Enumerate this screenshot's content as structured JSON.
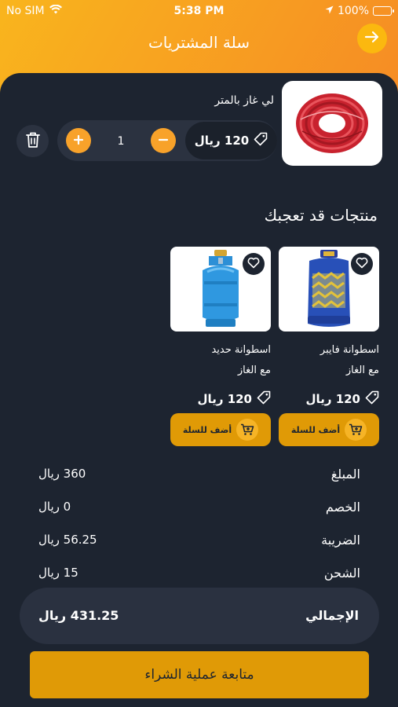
{
  "status_bar": {
    "carrier": "No SIM",
    "time": "5:38 PM",
    "battery": "100%"
  },
  "header": {
    "title": "سلة المشتريات",
    "back_icon": "arrow-right-icon"
  },
  "cart": {
    "items": [
      {
        "name": "لي غاز بالمتر",
        "price": "120 ريال",
        "quantity": "1",
        "image_icon": "red-gas-hose-image"
      }
    ]
  },
  "suggestions": {
    "title": "منتجات قد تعجبك",
    "products": [
      {
        "name": "اسطوانة فايبر",
        "subtitle": "مع الغاز",
        "price": "120 ريال",
        "add_label": "أضف للسلة",
        "image_icon": "blue-fiber-cylinder-image"
      },
      {
        "name": "اسطوانة حديد",
        "subtitle": "مع الغاز",
        "price": "120 ريال",
        "add_label": "أضف للسلة",
        "image_icon": "blue-steel-cylinder-image"
      }
    ]
  },
  "summary": {
    "amount_label": "المبلغ",
    "amount_value": "360 ريال",
    "discount_label": "الخصم",
    "discount_value": "0 ريال",
    "tax_label": "الضريبة",
    "tax_value": "56.25 ريال",
    "shipping_label": "الشحن",
    "shipping_value": "15 ريال",
    "total_label": "الإجمالي",
    "total_value": "431.25 ريال"
  },
  "checkout": {
    "label": "متابعة عملية الشراء"
  },
  "colors": {
    "accent": "#f8a22a",
    "panel_bg": "#1d2430",
    "button_gold": "#e09a06"
  }
}
